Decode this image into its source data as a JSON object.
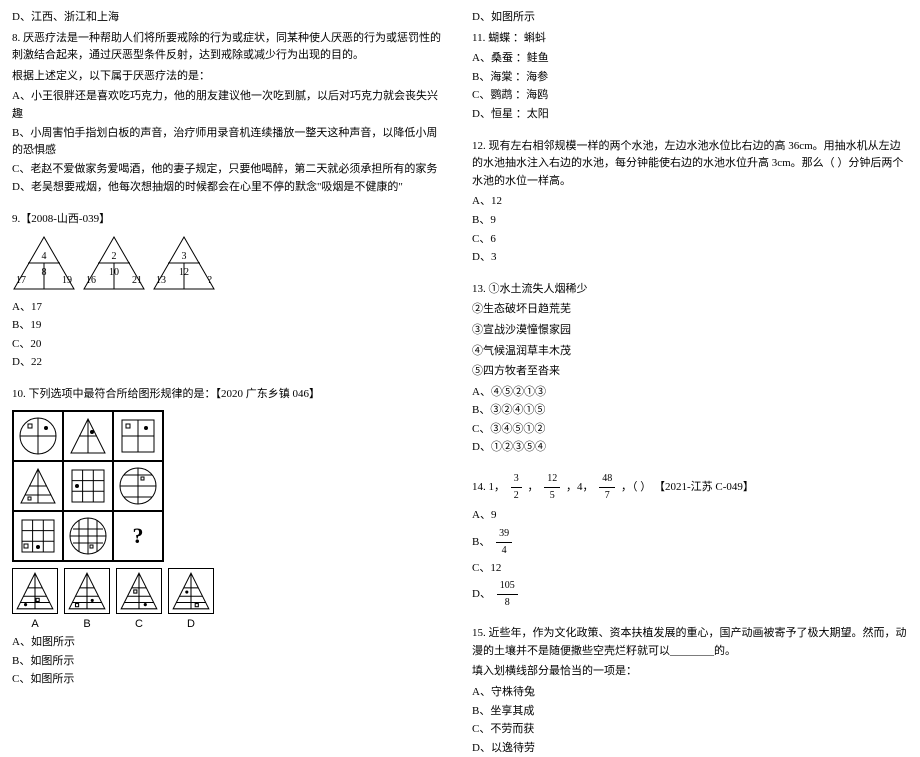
{
  "left": {
    "opt_d_top": "D、江西、浙江和上海",
    "q8": {
      "stem1": "8. 厌恶疗法是一种帮助人们将所要戒除的行为或症状，同某种使人厌恶的行为或惩罚性的刺激结合起来，通过厌恶型条件反射，达到戒除或减少行为出现的目的。",
      "stem2": "根据上述定义，以下属于厌恶疗法的是：",
      "A": "A、小王很胖还是喜欢吃巧克力，他的朋友建议他一次吃到腻，以后对巧克力就会丧失兴趣",
      "B": "B、小周害怕手指划白板的声音，治疗师用录音机连续播放一整天这种声音，以降低小周的恐惧感",
      "C": "C、老赵不爱做家务爱喝酒，他的妻子规定，只要他喝醉，第二天就必须承担所有的家务",
      "D": "D、老吴想要戒烟，他每次想抽烟的时候都会在心里不停的默念\"吸烟是不健康的\""
    },
    "q9": {
      "title": "9.【2008-山西-039】",
      "tri": [
        {
          "top": "4",
          "mid": "8",
          "bl": "17",
          "br": "19"
        },
        {
          "top": "2",
          "mid": "10",
          "bl": "16",
          "br": "21"
        },
        {
          "top": "3",
          "mid": "12",
          "bl": "13",
          "br": "?"
        }
      ],
      "A": "A、17",
      "B": "B、19",
      "C": "C、20",
      "D": "D、22"
    },
    "q10": {
      "title": "10. 下列选项中最符合所给图形规律的是：【2020 广东乡镇 046】",
      "ans_labels": [
        "A",
        "B",
        "C",
        "D"
      ],
      "A": "A、如图所示",
      "B": "B、如图所示",
      "C": "C、如图所示"
    }
  },
  "right": {
    "opt_d_top": "D、如图所示",
    "q11": {
      "title": "11. 蝴蝶 ：蝌蚪",
      "A": "A、桑蚕 ：鲑鱼",
      "B": "B、海棠 ：海参",
      "C": "C、鹦鹉 ：海鸥",
      "D": "D、恒星 ：太阳"
    },
    "q12": {
      "stem": "12. 现有左右相邻规模一样的两个水池，左边水池水位比右边的高 36cm。用抽水机从左边的水池抽水注入右边的水池，每分钟能使右边的水池水位升高 3cm。那么（ ）分钟后两个水池的水位一样高。",
      "A": "A、12",
      "B": "B、9",
      "C": "C、6",
      "D": "D、3"
    },
    "q13": {
      "title": "13. ①水土流失人烟稀少",
      "l2": "②生态破坏日趋荒芜",
      "l3": "③宣战沙漠憧憬家园",
      "l4": "④气候温润草丰木茂",
      "l5": "⑤四方牧者至沓来",
      "A": "A、④⑤②①③",
      "B": "B、③②④①⑤",
      "C": "C、③④⑤①②",
      "D": "D、①②③⑤④"
    },
    "q14": {
      "pre": "14.",
      "tag": "【2021-江苏 C-049】",
      "seq_prefix": "1，",
      "f1n": "3",
      "f1d": "2",
      "s1": "，",
      "f2n": "12",
      "f2d": "5",
      "s2": "，4，",
      "f3n": "48",
      "f3d": "7",
      "s3": "，（   ）",
      "A": "A、9",
      "Bn": "39",
      "Bd": "4",
      "Bpre": "B、",
      "C": "C、12",
      "Dn": "105",
      "Dd": "8",
      "Dpre": "D、"
    },
    "q15": {
      "stem": "15. 近些年，作为文化政策、资本扶植发展的重心，国产动画被寄予了极大期望。然而，动漫的土壤并不是随便撒些空壳烂籽就可以________的。",
      "inst": "填入划横线部分最恰当的一项是：",
      "A": "A、守株待兔",
      "B": "B、坐享其成",
      "C": "C、不劳而获",
      "D": "D、以逸待劳"
    }
  }
}
